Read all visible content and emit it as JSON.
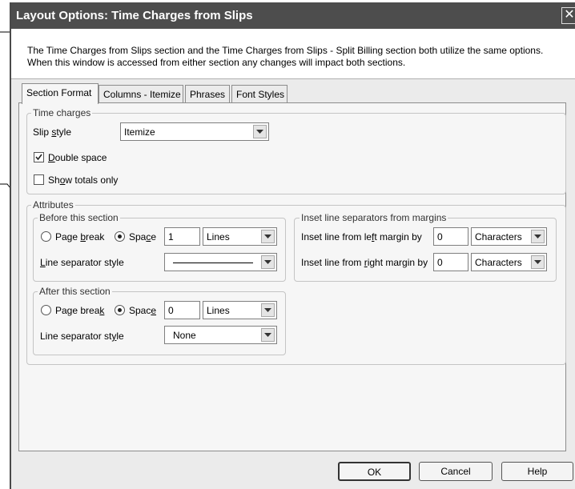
{
  "window": {
    "title": "Layout Options: Time Charges from Slips",
    "close_glyph": "✕"
  },
  "info_text": "The Time Charges from Slips section and the Time Charges from Slips - Split Billing section both utilize the same options. When this window is accessed from either section any changes will impact both sections.",
  "tabs": [
    {
      "label": "Section Format",
      "active": true
    },
    {
      "label": "Columns - Itemize",
      "active": false
    },
    {
      "label": "Phrases",
      "active": false
    },
    {
      "label": "Font Styles",
      "active": false
    }
  ],
  "time_charges": {
    "legend": "Time charges",
    "slip_style_label": "Slip style",
    "slip_style_value": "Itemize",
    "double_space_label": "Double space",
    "double_space_checked": true,
    "show_totals_label": "Show totals only",
    "show_totals_checked": false
  },
  "attributes": {
    "legend": "Attributes",
    "before": {
      "legend": "Before this section",
      "page_break_label": "Page break",
      "space_label": "Space",
      "selected": "space",
      "space_value": "1",
      "unit_value": "Lines",
      "line_sep_label": "Line separator style",
      "line_sep_value": "solid-line"
    },
    "after": {
      "legend": "After this section",
      "page_break_label": "Page break",
      "space_label": "Space",
      "selected": "space",
      "space_value": "0",
      "unit_value": "Lines",
      "line_sep_label": "Line separator style",
      "line_sep_value": "None"
    },
    "inset": {
      "legend": "Inset line separators from margins",
      "left_label": "Inset line from left margin by",
      "left_value": "0",
      "left_unit": "Characters",
      "right_label": "Inset line from right margin by",
      "right_value": "0",
      "right_unit": "Characters"
    }
  },
  "buttons": {
    "ok": "OK",
    "cancel": "Cancel",
    "help": "Help"
  }
}
